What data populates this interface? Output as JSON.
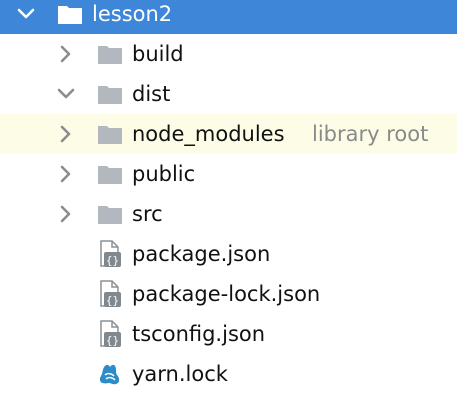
{
  "colors": {
    "selection": "#3d86d8",
    "highlight_row": "#fdfde7",
    "folder_gray": "#b2b8be",
    "arrow_gray": "#8c8c8c",
    "json_badge": "#808890",
    "yarn_blue": "#2a8cc8",
    "hint_gray": "#8a8a8a"
  },
  "tree": {
    "root": {
      "label": "lesson2",
      "expanded": true,
      "icon": "folder-icon"
    },
    "children": [
      {
        "label": "build",
        "expanded": false,
        "icon": "folder-icon"
      },
      {
        "label": "dist",
        "expanded": true,
        "icon": "folder-icon"
      },
      {
        "label": "node_modules",
        "hint": "library root",
        "expanded": false,
        "icon": "folder-icon"
      },
      {
        "label": "public",
        "expanded": false,
        "icon": "folder-icon"
      },
      {
        "label": "src",
        "expanded": false,
        "icon": "folder-icon"
      },
      {
        "label": "package.json",
        "icon": "json-file-icon"
      },
      {
        "label": "package-lock.json",
        "icon": "json-file-icon"
      },
      {
        "label": "tsconfig.json",
        "icon": "json-file-icon"
      },
      {
        "label": "yarn.lock",
        "icon": "yarn-icon"
      }
    ]
  }
}
